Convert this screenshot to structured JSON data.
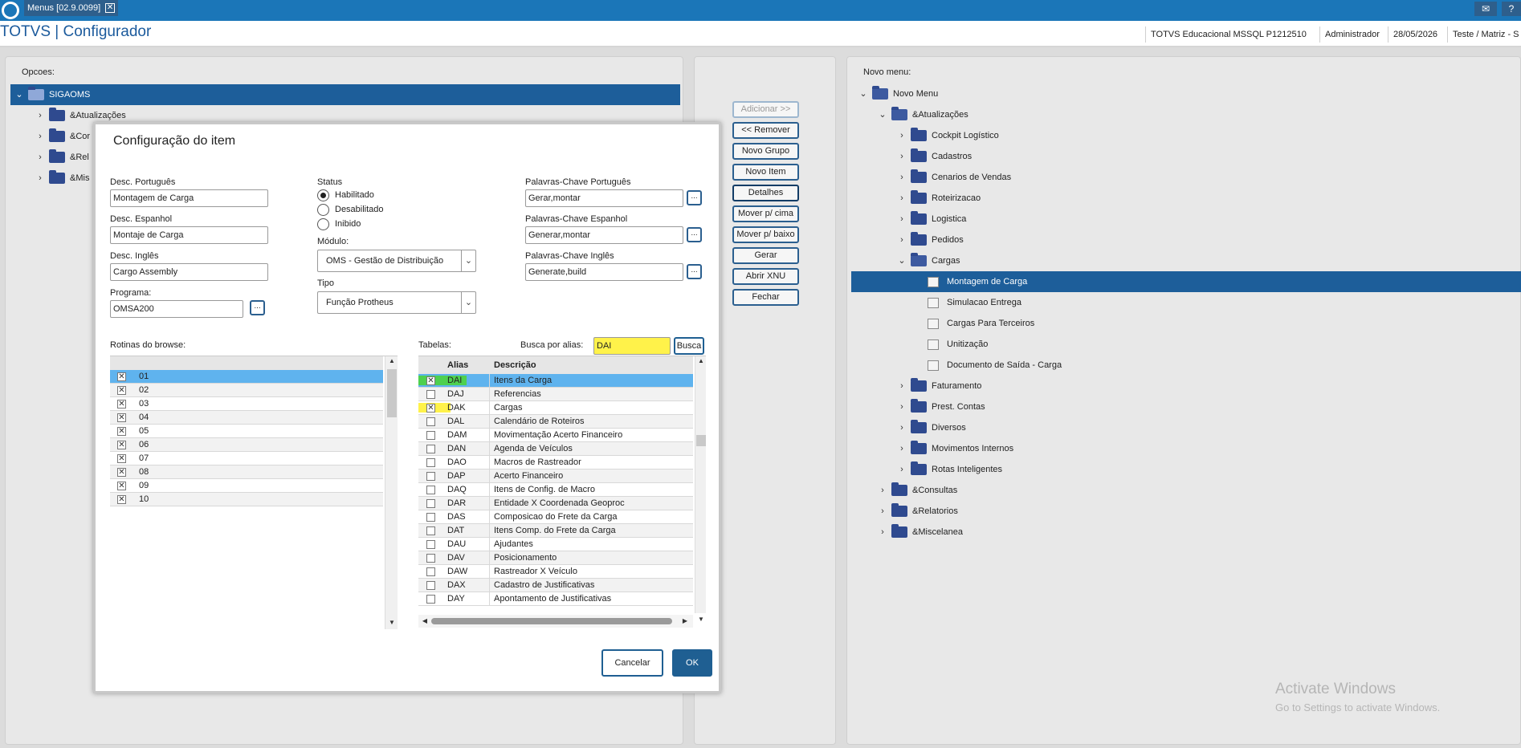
{
  "tabbar": {
    "tab_label": "Menus [02.9.0099]",
    "close_glyph": "✕",
    "mail_glyph": "✉",
    "help_glyph": "?"
  },
  "header": {
    "title": "TOTVS | Configurador",
    "environment": "TOTVS Educacional MSSQL P1212510",
    "user": "Administrador",
    "date": "28/05/2026",
    "company": "Teste / Matriz - S"
  },
  "left_panel": {
    "label": "Opcoes:",
    "root": "SIGAOMS",
    "items": [
      "&Atualizações",
      "&Cor",
      "&Rel",
      "&Mis"
    ]
  },
  "middle_buttons": [
    {
      "label": "Adicionar >>",
      "enabled": false
    },
    {
      "label": "<< Remover",
      "enabled": true
    },
    {
      "label": "Novo Grupo",
      "enabled": true
    },
    {
      "label": "Novo Item",
      "enabled": true
    },
    {
      "label": "Detalhes",
      "enabled": true
    },
    {
      "label": "Mover p/ cima",
      "enabled": true
    },
    {
      "label": "Mover p/ baixo",
      "enabled": true
    },
    {
      "label": "Gerar",
      "enabled": true
    },
    {
      "label": "Abrir XNU",
      "enabled": true
    },
    {
      "label": "Fechar",
      "enabled": true
    }
  ],
  "right_panel": {
    "label": "Novo menu:",
    "root": "Novo Menu",
    "atualizacoes": "&Atualizações",
    "groups_before": [
      "Cockpit Logístico",
      "Cadastros",
      "Cenarios de Vendas",
      "Roteirizacao",
      "Logistica",
      "Pedidos"
    ],
    "cargas": "Cargas",
    "cargas_items": [
      "Montagem de Carga",
      "Simulacao Entrega",
      "Cargas Para Terceiros",
      "Unitização",
      "Documento de Saída - Carga"
    ],
    "groups_after": [
      "Faturamento",
      "Prest. Contas",
      "Diversos",
      "Movimentos Internos",
      "Rotas Inteligentes"
    ],
    "top_level": [
      "&Consultas",
      "&Relatorios",
      "&Miscelanea"
    ]
  },
  "dialog": {
    "title": "Configuração do item",
    "desc_pt_label": "Desc. Português",
    "desc_pt": "Montagem de Carga",
    "desc_es_label": "Desc. Espanhol",
    "desc_es": "Montaje de Carga",
    "desc_en_label": "Desc. Inglês",
    "desc_en": "Cargo Assembly",
    "programa_label": "Programa:",
    "programa": "OMSA200",
    "ellipsis": "...",
    "status_label": "Status",
    "status_options": [
      "Habilitado",
      "Desabilitado",
      "Inibido"
    ],
    "status_selected": "Habilitado",
    "modulo_label": "Módulo:",
    "modulo": "OMS - Gestão de Distribuição",
    "tipo_label": "Tipo",
    "tipo": "Função Protheus",
    "kw_pt_label": "Palavras-Chave Português",
    "kw_pt": "Gerar,montar",
    "kw_es_label": "Palavras-Chave Espanhol",
    "kw_es": "Generar,montar",
    "kw_en_label": "Palavras-Chave Inglês",
    "kw_en": "Generate,build",
    "rotinas_label": "Rotinas do browse:",
    "rotinas": [
      "01",
      "02",
      "03",
      "04",
      "05",
      "06",
      "07",
      "08",
      "09",
      "10"
    ],
    "tabelas_label": "Tabelas:",
    "busca_label": "Busca por alias:",
    "busca_value": "DAI",
    "busca_button": "Busca",
    "col_alias": "Alias",
    "col_desc": "Descrição",
    "tabelas": [
      {
        "alias": "DAI",
        "desc": "Itens da Carga",
        "checked": true
      },
      {
        "alias": "DAJ",
        "desc": "Referencias",
        "checked": false
      },
      {
        "alias": "DAK",
        "desc": "Cargas",
        "checked": true
      },
      {
        "alias": "DAL",
        "desc": "Calendário de Roteiros",
        "checked": false
      },
      {
        "alias": "DAM",
        "desc": "Movimentação Acerto Financeiro",
        "checked": false
      },
      {
        "alias": "DAN",
        "desc": "Agenda de Veículos",
        "checked": false
      },
      {
        "alias": "DAO",
        "desc": "Macros de Rastreador",
        "checked": false
      },
      {
        "alias": "DAP",
        "desc": "Acerto Financeiro",
        "checked": false
      },
      {
        "alias": "DAQ",
        "desc": "Itens de Config. de Macro",
        "checked": false
      },
      {
        "alias": "DAR",
        "desc": "Entidade X Coordenada Geoproc",
        "checked": false
      },
      {
        "alias": "DAS",
        "desc": "Composicao do Frete da Carga",
        "checked": false
      },
      {
        "alias": "DAT",
        "desc": "Itens Comp. do Frete da Carga",
        "checked": false
      },
      {
        "alias": "DAU",
        "desc": "Ajudantes",
        "checked": false
      },
      {
        "alias": "DAV",
        "desc": "Posicionamento",
        "checked": false
      },
      {
        "alias": "DAW",
        "desc": "Rastreador X Veículo",
        "checked": false
      },
      {
        "alias": "DAX",
        "desc": "Cadastro de Justificativas",
        "checked": false
      },
      {
        "alias": "DAY",
        "desc": "Apontamento de Justificativas",
        "checked": false
      }
    ],
    "cancel_label": "Cancelar",
    "ok_label": "OK"
  },
  "watermark": {
    "line1": "Activate Windows",
    "line2": "Go to Settings to activate Windows."
  },
  "colors": {
    "brand": "#1b76b8",
    "selection": "#1d5e9a",
    "grid_selection": "#5fb3ee",
    "highlight": "#fff24a"
  }
}
